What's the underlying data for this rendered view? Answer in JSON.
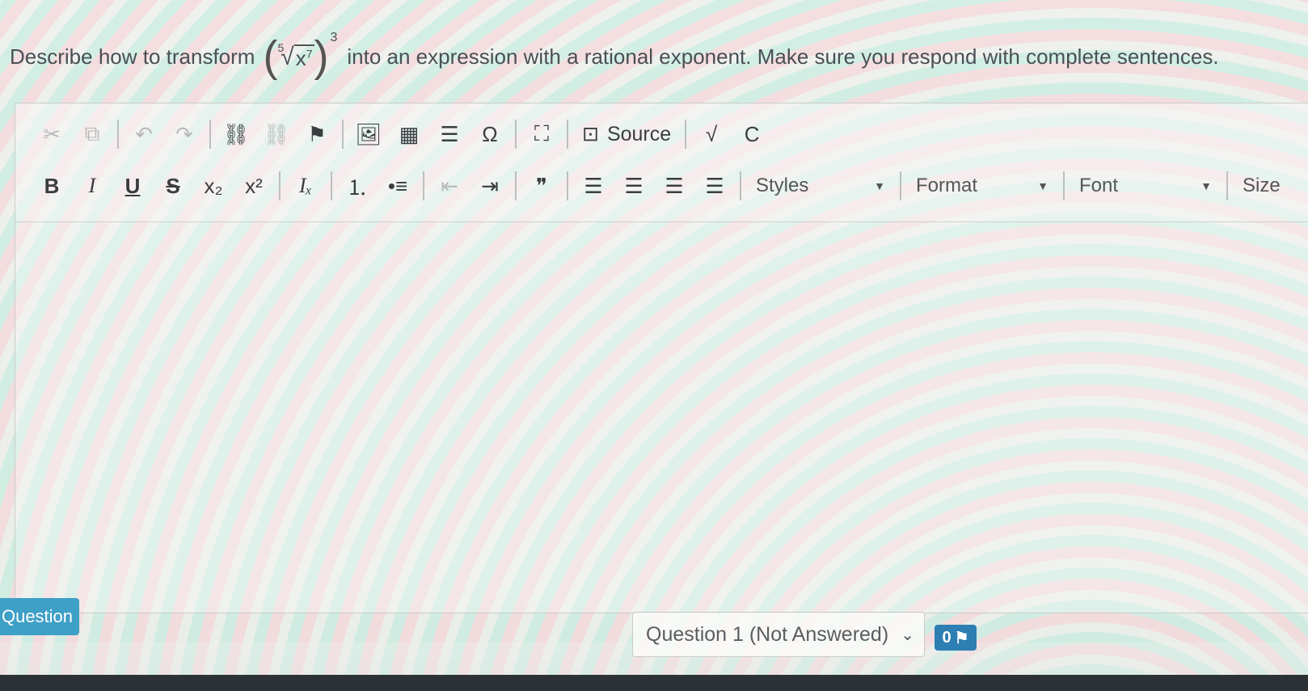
{
  "prompt": {
    "before": "Describe how to transform",
    "math": {
      "index": "5",
      "base": "x",
      "base_exp": "7",
      "outer_exp": "3"
    },
    "after": "into an expression with a rational exponent. Make sure you respond with complete sentences."
  },
  "toolbar": {
    "row1": [
      {
        "name": "cut-button",
        "icon": "scissors-icon",
        "glyph": "✂",
        "enabled": false
      },
      {
        "name": "copy-button",
        "icon": "copy-icon",
        "glyph": "⧉",
        "enabled": false
      },
      {
        "sep": true
      },
      {
        "name": "undo-button",
        "icon": "undo-icon",
        "glyph": "↶",
        "enabled": false
      },
      {
        "name": "redo-button",
        "icon": "redo-icon",
        "glyph": "↷",
        "enabled": false
      },
      {
        "sep": true
      },
      {
        "name": "link-button",
        "icon": "link-icon",
        "glyph": "⛓",
        "enabled": true
      },
      {
        "name": "unlink-button",
        "icon": "unlink-icon",
        "glyph": "⛓",
        "enabled": false
      },
      {
        "name": "anchor-button",
        "icon": "flag-icon",
        "glyph": "⚑",
        "enabled": true
      },
      {
        "sep": true
      },
      {
        "name": "image-button",
        "icon": "image-icon",
        "glyph": "🖼",
        "enabled": true
      },
      {
        "name": "table-button",
        "icon": "table-icon",
        "glyph": "▦",
        "enabled": true
      },
      {
        "name": "horizontal-line-button",
        "icon": "horizontal-rule-icon",
        "glyph": "☰",
        "enabled": true
      },
      {
        "name": "special-char-button",
        "icon": "omega-icon",
        "glyph": "Ω",
        "enabled": true
      },
      {
        "sep": true
      },
      {
        "name": "maximize-button",
        "icon": "maximize-icon",
        "glyph": "⛶",
        "enabled": true
      },
      {
        "sep": true
      },
      {
        "name": "source-button",
        "icon": "source-icon",
        "glyph": "⊡",
        "label": "Source",
        "enabled": true
      },
      {
        "sep": true
      },
      {
        "name": "math-button",
        "icon": "square-root-icon",
        "glyph": "√",
        "enabled": true
      },
      {
        "name": "chemistry-button",
        "icon": "c-icon",
        "glyph": "C",
        "enabled": true
      }
    ],
    "row2": [
      {
        "name": "bold-button",
        "icon": "bold-icon",
        "glyph": "B",
        "style": "bold",
        "enabled": true
      },
      {
        "name": "italic-button",
        "icon": "italic-icon",
        "glyph": "I",
        "style": "italic",
        "enabled": true
      },
      {
        "name": "underline-button",
        "icon": "underline-icon",
        "glyph": "U",
        "style": "under",
        "enabled": true
      },
      {
        "name": "strike-button",
        "icon": "strikethrough-icon",
        "glyph": "S",
        "style": "strike",
        "enabled": true
      },
      {
        "name": "subscript-button",
        "icon": "subscript-icon",
        "glyph": "x₂",
        "enabled": true
      },
      {
        "name": "superscript-button",
        "icon": "superscript-icon",
        "glyph": "x²",
        "enabled": true
      },
      {
        "sep": true
      },
      {
        "name": "remove-format-button",
        "icon": "clear-format-icon",
        "glyph": "Iₓ",
        "style": "italic",
        "enabled": true
      },
      {
        "sep": true
      },
      {
        "name": "numbered-list-button",
        "icon": "numbered-list-icon",
        "glyph": "⒈",
        "enabled": true
      },
      {
        "name": "bullet-list-button",
        "icon": "bullet-list-icon",
        "glyph": "•≡",
        "enabled": true
      },
      {
        "sep": true
      },
      {
        "name": "outdent-button",
        "icon": "outdent-icon",
        "glyph": "⇤",
        "enabled": false
      },
      {
        "name": "indent-button",
        "icon": "indent-icon",
        "glyph": "⇥",
        "enabled": true
      },
      {
        "sep": true
      },
      {
        "name": "blockquote-button",
        "icon": "quote-icon",
        "glyph": "❞",
        "enabled": true
      },
      {
        "sep": true
      },
      {
        "name": "align-left-button",
        "icon": "align-left-icon",
        "glyph": "☰",
        "enabled": true
      },
      {
        "name": "align-center-button",
        "icon": "align-center-icon",
        "glyph": "☰",
        "enabled": true
      },
      {
        "name": "align-right-button",
        "icon": "align-right-icon",
        "glyph": "☰",
        "enabled": true
      },
      {
        "name": "justify-button",
        "icon": "align-justify-icon",
        "glyph": "☰",
        "enabled": true
      },
      {
        "sep": true
      }
    ],
    "combos": {
      "styles": "Styles",
      "format": "Format",
      "font": "Font",
      "size": "Size"
    }
  },
  "footer": {
    "question_tab": "Question",
    "question_select": "Question 1 (Not Answered)",
    "flag_count": "0"
  }
}
